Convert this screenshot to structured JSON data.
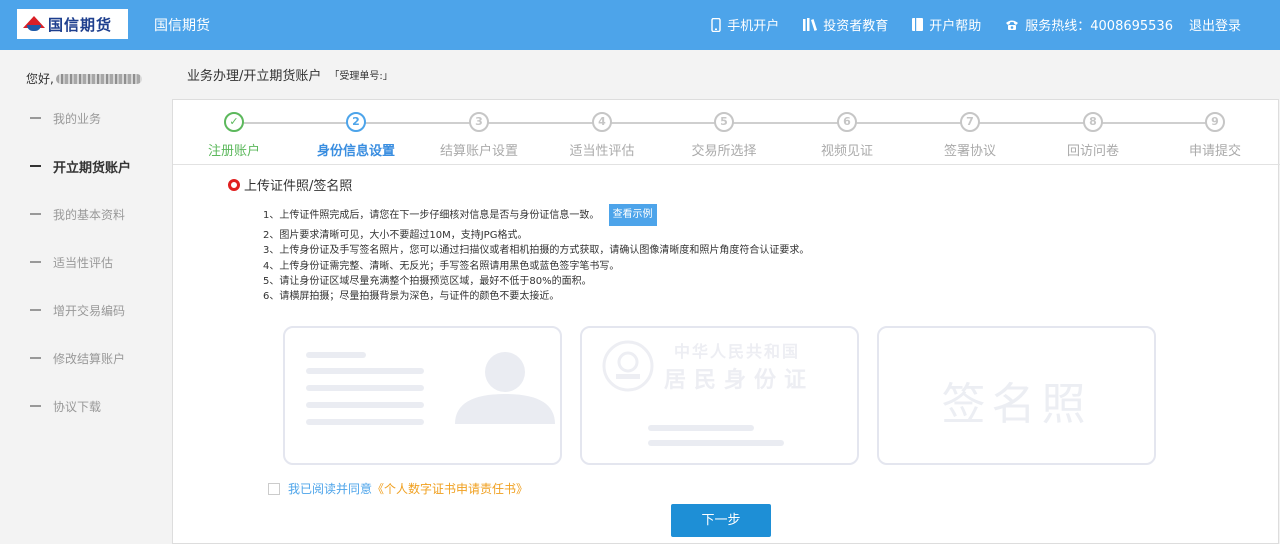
{
  "header": {
    "logo_text": "国信期货",
    "brand": "国信期货",
    "nav": {
      "mobile": "手机开户",
      "investor_edu": "投资者教育",
      "help": "开户帮助",
      "hotline": "服务热线：4008695536",
      "logout": "退出登录"
    }
  },
  "sidebar": {
    "greeting": "您好,",
    "items": [
      {
        "label": "我的业务"
      },
      {
        "label": "开立期货账户"
      },
      {
        "label": "我的基本资料"
      },
      {
        "label": "适当性评估"
      },
      {
        "label": "增开交易编码"
      },
      {
        "label": "修改结算账户"
      },
      {
        "label": "协议下载"
      }
    ]
  },
  "breadcrumb": {
    "path": "业务办理/开立期货账户",
    "ticket": "「受理单号:」"
  },
  "steps": [
    {
      "num": "✓",
      "label": "注册账户",
      "state": "done"
    },
    {
      "num": "2",
      "label": "身份信息设置",
      "state": "current"
    },
    {
      "num": "3",
      "label": "结算账户设置",
      "state": "todo"
    },
    {
      "num": "4",
      "label": "适当性评估",
      "state": "todo"
    },
    {
      "num": "5",
      "label": "交易所选择",
      "state": "todo"
    },
    {
      "num": "6",
      "label": "视频见证",
      "state": "todo"
    },
    {
      "num": "7",
      "label": "签署协议",
      "state": "todo"
    },
    {
      "num": "8",
      "label": "回访问卷",
      "state": "todo"
    },
    {
      "num": "9",
      "label": "申请提交",
      "state": "todo"
    }
  ],
  "upload": {
    "title": "上传证件照/签名照",
    "example_button": "查看示例",
    "instructions": [
      "1、上传证件照完成后，请您在下一步仔细核对信息是否与身份证信息一致。",
      "2、图片要求清晰可见，大小不要超过10M，支持JPG格式。",
      "3、上传身份证及手写签名照片，您可以通过扫描仪或者相机拍摄的方式获取，请确认图像清晰度和照片角度符合认证要求。",
      "4、上传身份证需完整、清晰、无反光；手写签名照请用黑色或蓝色签字笔书写。",
      "5、请让身份证区域尽量充满整个拍摄预览区域，最好不低于80%的面积。",
      "6、请横屏拍摄；尽量拍摄背景为深色，与证件的颜色不要太接近。"
    ],
    "card_back_line1": "中华人民共和国",
    "card_back_line2": "居民身份证",
    "signature_text": "签名照"
  },
  "agreement": {
    "prefix": "我已阅读并同意",
    "doc": "《个人数字证书申请责任书》"
  },
  "next_button": "下一步",
  "colors": {
    "header_bg": "#4da4ea",
    "done": "#5cb85c",
    "current": "#4da4ea",
    "button": "#1e8fd6",
    "link_orange": "#f0a020"
  }
}
